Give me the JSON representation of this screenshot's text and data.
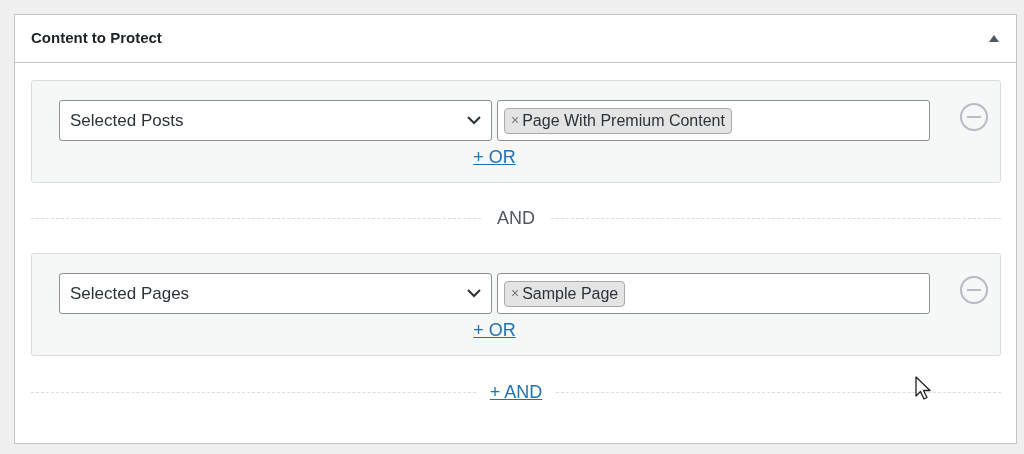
{
  "panel": {
    "title": "Content to Protect",
    "expanded": true
  },
  "rule_groups": [
    {
      "select": "Selected Posts",
      "tags": [
        {
          "remove": "×",
          "label": "Page With Premium Content"
        }
      ],
      "or_link": "+ OR"
    },
    {
      "select": "Selected Pages",
      "tags": [
        {
          "remove": "×",
          "label": "Sample Page"
        }
      ],
      "or_link": "+ OR"
    }
  ],
  "group_separators": [
    "AND"
  ],
  "add_and_link": "+ AND"
}
